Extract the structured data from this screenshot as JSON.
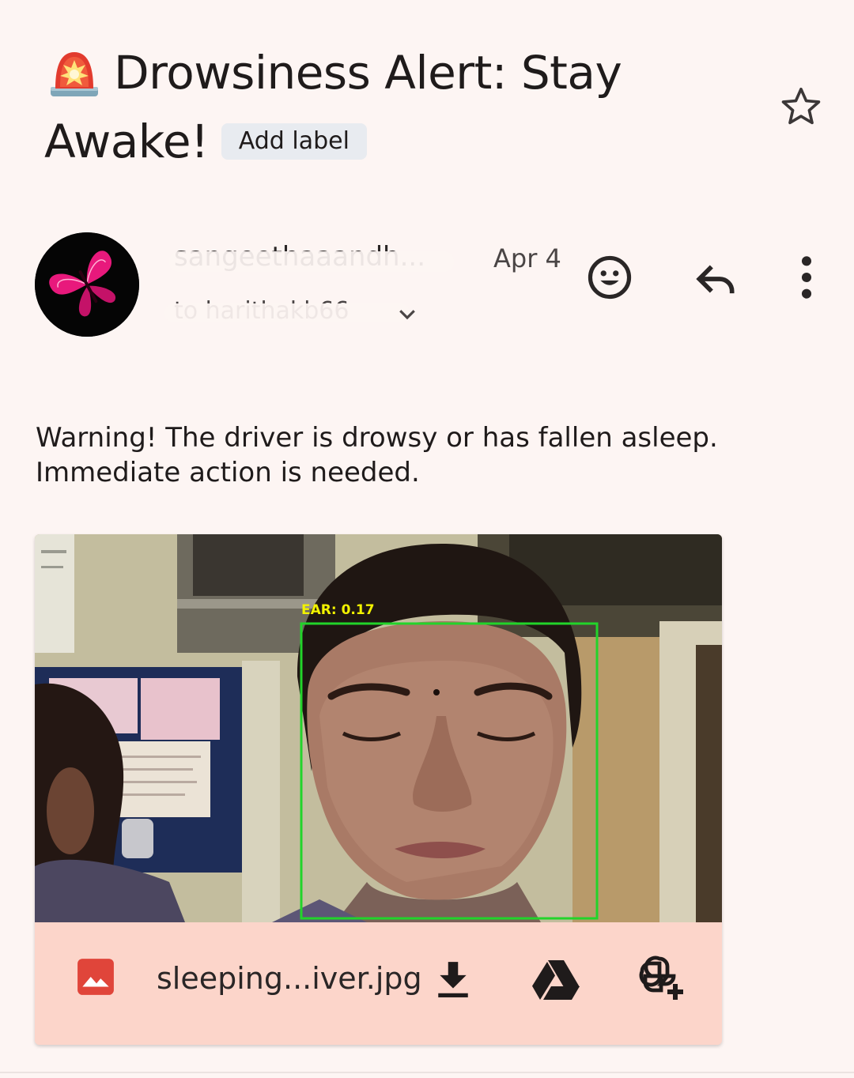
{
  "email": {
    "subject_line1": "Drowsiness Alert: Stay",
    "subject_line2": "Awake!",
    "add_label": "Add label",
    "sender_name": "sangeethaaandh...",
    "date": "Apr 4",
    "recipient": "to harithakb66",
    "body": "Warning! The driver is drowsy or has fallen asleep. Immediate action is needed."
  },
  "attachment": {
    "filename": "sleeping...iver.jpg",
    "overlay_text": "EAR: 0.17",
    "overlay_color": "#f2f200",
    "box_color": "#22d42a"
  },
  "icons": {
    "siren": "siren-emoji-icon",
    "star": "star-outline-icon",
    "emoji": "add-reaction-icon",
    "reply": "reply-icon",
    "more": "more-vertical-icon",
    "image": "image-file-icon",
    "download": "download-icon",
    "drive": "google-drive-icon",
    "photos": "add-to-photos-icon"
  },
  "colors": {
    "background": "#fdf5f3",
    "attachment_bar": "#fcd5ca",
    "label_chip": "#e8ebf0",
    "image_icon": "#e0453a"
  }
}
